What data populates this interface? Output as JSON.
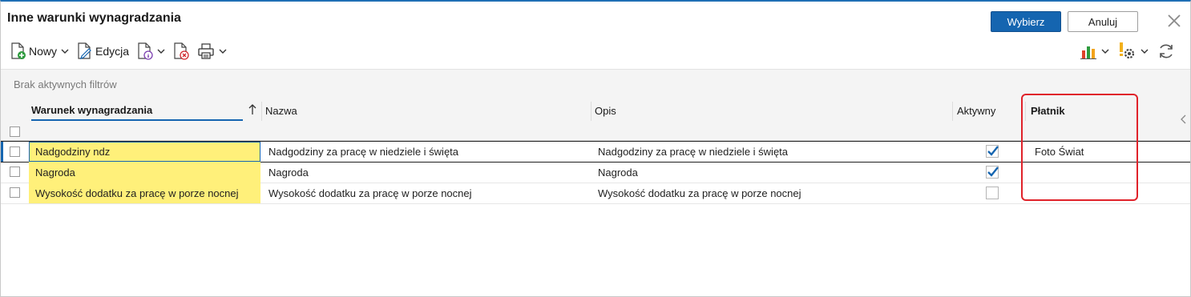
{
  "window": {
    "title": "Inne warunki wynagradzania"
  },
  "buttons": {
    "select": "Wybierz",
    "cancel": "Anuluj"
  },
  "toolbar": {
    "new_label": "Nowy",
    "edit_label": "Edycja"
  },
  "filter": {
    "status_text": "Brak aktywnych filtrów"
  },
  "grid": {
    "columns": [
      "Warunek wynagradzania",
      "Nazwa",
      "Opis",
      "Aktywny",
      "Płatnik"
    ],
    "sort": {
      "column": "Warunek wynagradzania",
      "direction": "ascending"
    },
    "rows": [
      {
        "warunek": "Nadgodziny ndz",
        "nazwa": "Nadgodziny za pracę w niedziele i święta",
        "opis": "Nadgodziny za pracę w niedziele i święta",
        "aktywny": true,
        "platnik": "Foto Świat",
        "selected": true
      },
      {
        "warunek": "Nagroda",
        "nazwa": "Nagroda",
        "opis": "Nagroda",
        "aktywny": true,
        "platnik": "",
        "selected": false
      },
      {
        "warunek": "Wysokość dodatku za pracę w porze nocnej",
        "nazwa": "Wysokość dodatku za pracę w porze nocnej",
        "opis": "Wysokość dodatku za pracę w porze nocnej",
        "aktywny": false,
        "platnik": "",
        "selected": false
      }
    ]
  },
  "colors": {
    "accent": "#1565b0",
    "highlight": "#fff07a",
    "annotation": "#e0222a"
  },
  "icons": [
    "new-document-icon",
    "edit-document-icon",
    "document-info-icon",
    "delete-document-icon",
    "print-icon",
    "chart-icon",
    "settings-warning-icon",
    "refresh-icon",
    "close-icon",
    "sort-ascending-icon",
    "chevron-left-icon"
  ]
}
